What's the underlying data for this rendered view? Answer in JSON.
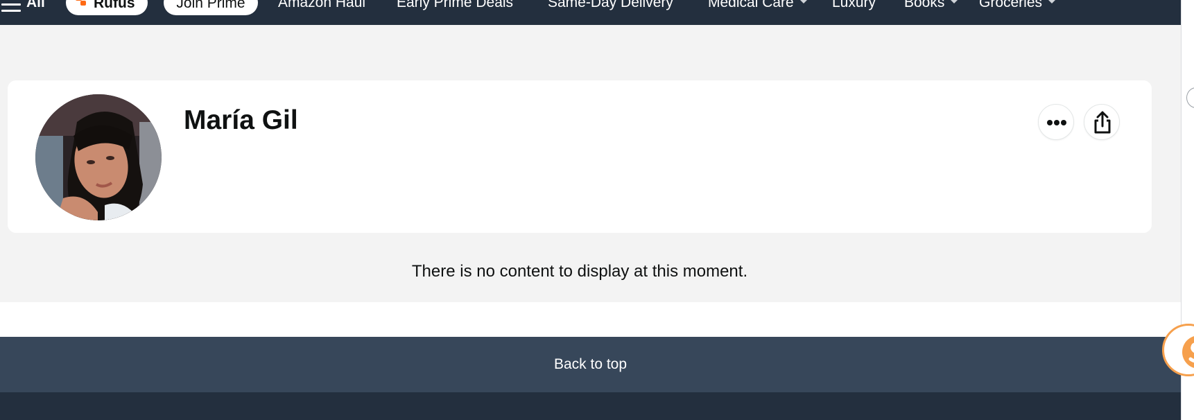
{
  "nav": {
    "all_label": "All",
    "rufus_label": "Rufus",
    "join_prime_label": "Join Prime",
    "links": [
      {
        "label": "Amazon Haul"
      },
      {
        "label": "Early Prime Deals"
      },
      {
        "label": "Same-Day Delivery"
      },
      {
        "label": "Medical Care"
      },
      {
        "label": "Luxury"
      },
      {
        "label": "Books"
      },
      {
        "label": "Groceries"
      }
    ]
  },
  "profile": {
    "name": "María Gil",
    "avatar_icon": "profile-photo"
  },
  "actions": {
    "more_icon": "more-options-icon",
    "share_icon": "share-icon"
  },
  "content": {
    "empty_message": "There is no content to display at this moment."
  },
  "footer": {
    "back_to_top": "Back to top"
  },
  "colors": {
    "nav_bg": "#232f3e",
    "back_to_top_bg": "#37475a",
    "page_bg": "#f3f3f3",
    "rufus_accent": "#ff6a13",
    "floating_accent": "#f6a04d"
  }
}
